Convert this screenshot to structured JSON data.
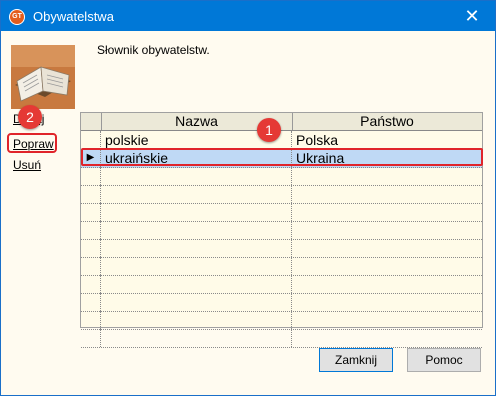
{
  "window": {
    "title": "Obywatelstwa",
    "app_icon_text": "GT",
    "close_glyph": "✕",
    "accent_color": "#0078d7"
  },
  "description": "Słownik obywatelstw.",
  "sidebar": {
    "add_label": "Dodaj",
    "edit_label": "Popraw",
    "delete_label": "Usuń"
  },
  "grid": {
    "columns": [
      "Nazwa",
      "Państwo"
    ],
    "rows": [
      {
        "nazwa": "polskie",
        "panstwo": "Polska",
        "selected": false
      },
      {
        "nazwa": "ukraińskie",
        "panstwo": "Ukraina",
        "selected": true
      }
    ],
    "empty_row_count": 10,
    "current_row_marker": "▶"
  },
  "annotations": {
    "badge_1": "1",
    "badge_2": "2",
    "highlight_color": "#e0242a"
  },
  "buttons": {
    "close_label": "Zamknij",
    "help_label": "Pomoc"
  }
}
